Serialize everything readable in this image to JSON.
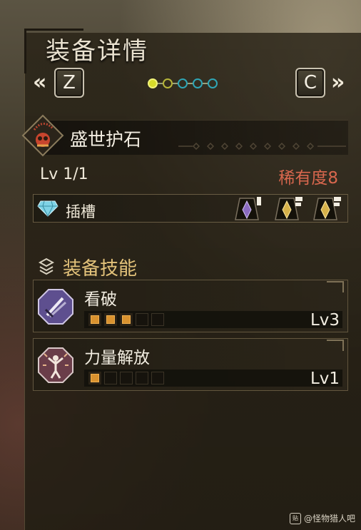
{
  "header": {
    "title": "装备详情",
    "left_arrow": "«",
    "right_arrow": "»",
    "left_key": "Z",
    "right_key": "C",
    "page_dots": [
      "#d8dc2a",
      "#b7b63a",
      "#2fa6b6",
      "#2fa6b6",
      "#2fa6b6"
    ]
  },
  "item": {
    "name": "盛世护石",
    "level": "Lv 1/1",
    "rarity": "稀有度8"
  },
  "slots": {
    "label": "插槽",
    "decoration_slots": [
      {
        "icon": "slot-level-1-icon",
        "color": "#8a6bc0"
      },
      {
        "icon": "slot-level-2-icon",
        "color": "#d6b24a"
      },
      {
        "icon": "slot-level-2-icon",
        "color": "#d6b24a"
      }
    ]
  },
  "skills_section": {
    "title": "装备技能",
    "skills": [
      {
        "name": "看破",
        "level": "Lv3",
        "filled": 3,
        "max": 5,
        "icon": "blades-icon",
        "icon_color": "#5e4f8f"
      },
      {
        "name": "力量解放",
        "level": "Lv1",
        "filled": 1,
        "max": 5,
        "icon": "burst-figure-icon",
        "icon_color": "#6a3d49"
      }
    ]
  },
  "watermark": {
    "badge": "贴",
    "text": "@怪物猎人吧"
  },
  "colors": {
    "rarity": "#d9674e",
    "section_title": "#e3c27a",
    "pip_on": "#d9922f"
  }
}
